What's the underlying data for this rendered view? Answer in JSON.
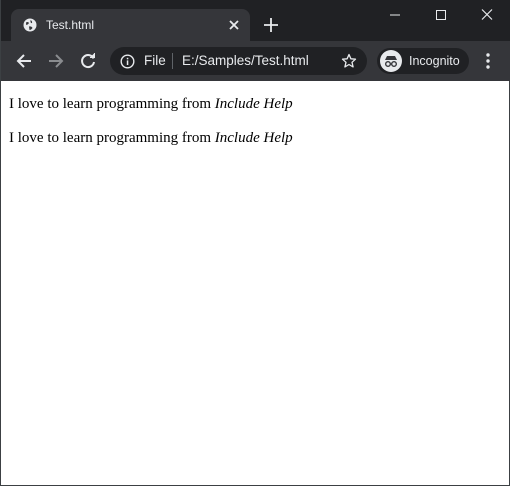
{
  "browser": {
    "tab": {
      "title": "Test.html",
      "icon": "globe-icon"
    },
    "new_tab_icon": "plus-icon",
    "window_controls": [
      "minimize-icon",
      "maximize-icon",
      "close-icon"
    ],
    "toolbar": {
      "back_icon": "arrow-left-icon",
      "forward_icon": "arrow-right-icon",
      "reload_icon": "reload-icon",
      "address": {
        "scheme_label": "File",
        "url": "E:/Samples/Test.html"
      },
      "bookmark_icon": "star-icon",
      "profile_label": "Incognito",
      "menu_icon": "three-dots-icon"
    }
  },
  "page": {
    "paragraphs": [
      {
        "text": "I love to learn programming from ",
        "emphasis": "Include Help"
      },
      {
        "text": "I love to learn programming from ",
        "emphasis": "Include Help"
      }
    ]
  },
  "colors": {
    "titlebar": "#202124",
    "toolbar": "#35363a",
    "text_light": "#e8eaed"
  }
}
